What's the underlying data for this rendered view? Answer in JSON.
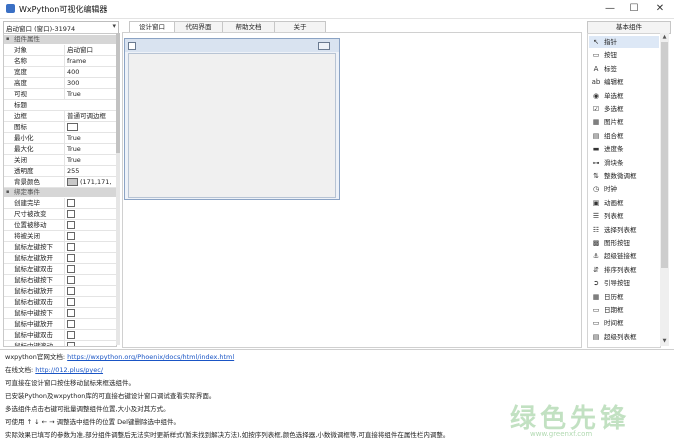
{
  "window": {
    "title": "WxPython可视化编辑器",
    "min_glyph": "—",
    "max_glyph": "☐",
    "close_glyph": "✕"
  },
  "left": {
    "selector": "启动窗口 (窗口)-31974",
    "categories": {
      "props": "组件属性",
      "events": "绑定事件"
    },
    "props": [
      {
        "k": "对象",
        "v": "启动窗口"
      },
      {
        "k": "名称",
        "v": "frame"
      },
      {
        "k": "宽度",
        "v": "400"
      },
      {
        "k": "高度",
        "v": "300"
      },
      {
        "k": "可视",
        "v": "True"
      },
      {
        "k": "标题",
        "v": ""
      },
      {
        "k": "边框",
        "v": "普通可调边框"
      },
      {
        "k": "图标",
        "v": "",
        "box": true
      },
      {
        "k": "最小化",
        "v": "True"
      },
      {
        "k": "最大化",
        "v": "True"
      },
      {
        "k": "关闭",
        "v": "True"
      },
      {
        "k": "透明度",
        "v": "255"
      },
      {
        "k": "背景颜色",
        "v": "(171,171,",
        "swatch": true
      }
    ],
    "events": [
      "创建完毕",
      "尺寸被改变",
      "位置被移动",
      "将被关闭",
      "鼠标左键按下",
      "鼠标左键放开",
      "鼠标左键双击",
      "鼠标右键按下",
      "鼠标右键放开",
      "鼠标右键双击",
      "鼠标中键按下",
      "鼠标中键放开",
      "鼠标中键双击",
      "鼠标中键滚动"
    ]
  },
  "tabs": [
    {
      "label": "设计窗口",
      "active": true
    },
    {
      "label": "代码界面",
      "active": false
    },
    {
      "label": "帮助文档",
      "active": false
    },
    {
      "label": "关于",
      "active": false
    }
  ],
  "palette": {
    "header": "基本组件",
    "items": [
      {
        "label": "指针",
        "icon": "↖"
      },
      {
        "label": "按钮",
        "icon": "▭"
      },
      {
        "label": "标签",
        "icon": "A"
      },
      {
        "label": "编辑框",
        "icon": "ab"
      },
      {
        "label": "单选框",
        "icon": "◉"
      },
      {
        "label": "多选框",
        "icon": "☑"
      },
      {
        "label": "图片框",
        "icon": "▦"
      },
      {
        "label": "组合框",
        "icon": "▤"
      },
      {
        "label": "进度条",
        "icon": "▬"
      },
      {
        "label": "滑块条",
        "icon": "⊶"
      },
      {
        "label": "整数微调框",
        "icon": "⇅"
      },
      {
        "label": "时钟",
        "icon": "◷"
      },
      {
        "label": "动画框",
        "icon": "▣"
      },
      {
        "label": "列表框",
        "icon": "☰"
      },
      {
        "label": "选择列表框",
        "icon": "☷"
      },
      {
        "label": "图形按钮",
        "icon": "▩"
      },
      {
        "label": "超级链接框",
        "icon": "⚓"
      },
      {
        "label": "排序列表框",
        "icon": "⇵"
      },
      {
        "label": "引导按钮",
        "icon": "➲"
      },
      {
        "label": "日历框",
        "icon": "▦"
      },
      {
        "label": "日期框",
        "icon": "▭"
      },
      {
        "label": "时间框",
        "icon": "▭"
      },
      {
        "label": "超级列表框",
        "icon": "▤"
      }
    ]
  },
  "log": {
    "doc_label": "wxpython官网文档:",
    "doc_link": "https://wxpython.org/Phoenix/docs/html/index.html",
    "online_label": "在线文档:",
    "online_link": "http://012.plus/pyec/",
    "line3": "可直接在设计窗口按住移动鼠标来框选组件。",
    "line4": "已安装Python及wxpython库的可直接右键设计窗口调试查看实际界面。",
    "line5": "多选组件点击右键可批量调整组件位置,大小及对其方式。",
    "line6": "可使用 ↑ ↓ ← → 调整选中组件的位置 Del键删除选中组件。",
    "line7": "实际效果已填写的参数为准,部分组件调整后无法实时更新样式(暂未找到解决方法),如按序列表框,颜色选择器,小数微调框等,可直接将组件在属性栏内调整。"
  },
  "watermark": {
    "text": "绿色先锋",
    "url": "www.greenxf.com"
  }
}
